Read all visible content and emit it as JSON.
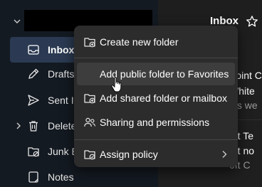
{
  "folders": [
    {
      "label": "Inbox",
      "icon": "inbox-icon"
    },
    {
      "label": "Drafts",
      "icon": "pencil-icon"
    },
    {
      "label": "Sent It",
      "icon": "send-icon"
    },
    {
      "label": "Delete",
      "icon": "trash-icon"
    },
    {
      "label": "Junk E",
      "icon": "junk-folder-icon"
    },
    {
      "label": "Notes",
      "icon": "notes-icon"
    }
  ],
  "header": {
    "title": "Inbox",
    "favorite_icon": "star-icon"
  },
  "message_list": {
    "lines": [
      {
        "text": "Point C",
        "dim": false
      },
      {
        "text": "White",
        "dim": false
      },
      {
        "text": "les we",
        "dim": true
      },
      {
        "text": "oft Te",
        "dim": false
      },
      {
        "text": "oft no",
        "dim": false
      },
      {
        "text": "oft C",
        "dim": true
      }
    ]
  },
  "context_menu": {
    "items": [
      {
        "label": "Create new folder",
        "icon": "new-folder-icon"
      },
      {
        "label": "Add public folder to Favorites",
        "icon": "",
        "hovered": true
      },
      {
        "label": "Add shared folder or mailbox",
        "icon": "shared-folder-icon"
      },
      {
        "label": "Sharing and permissions",
        "icon": "people-icon"
      },
      {
        "label": "Assign policy",
        "icon": "policy-icon",
        "submenu": true
      }
    ]
  },
  "colors": {
    "pane_bg": "#141a22",
    "selected_bg": "#2b3a52",
    "menu_bg": "#2c2c2c",
    "menu_hover_bg": "#3d3d3d"
  }
}
